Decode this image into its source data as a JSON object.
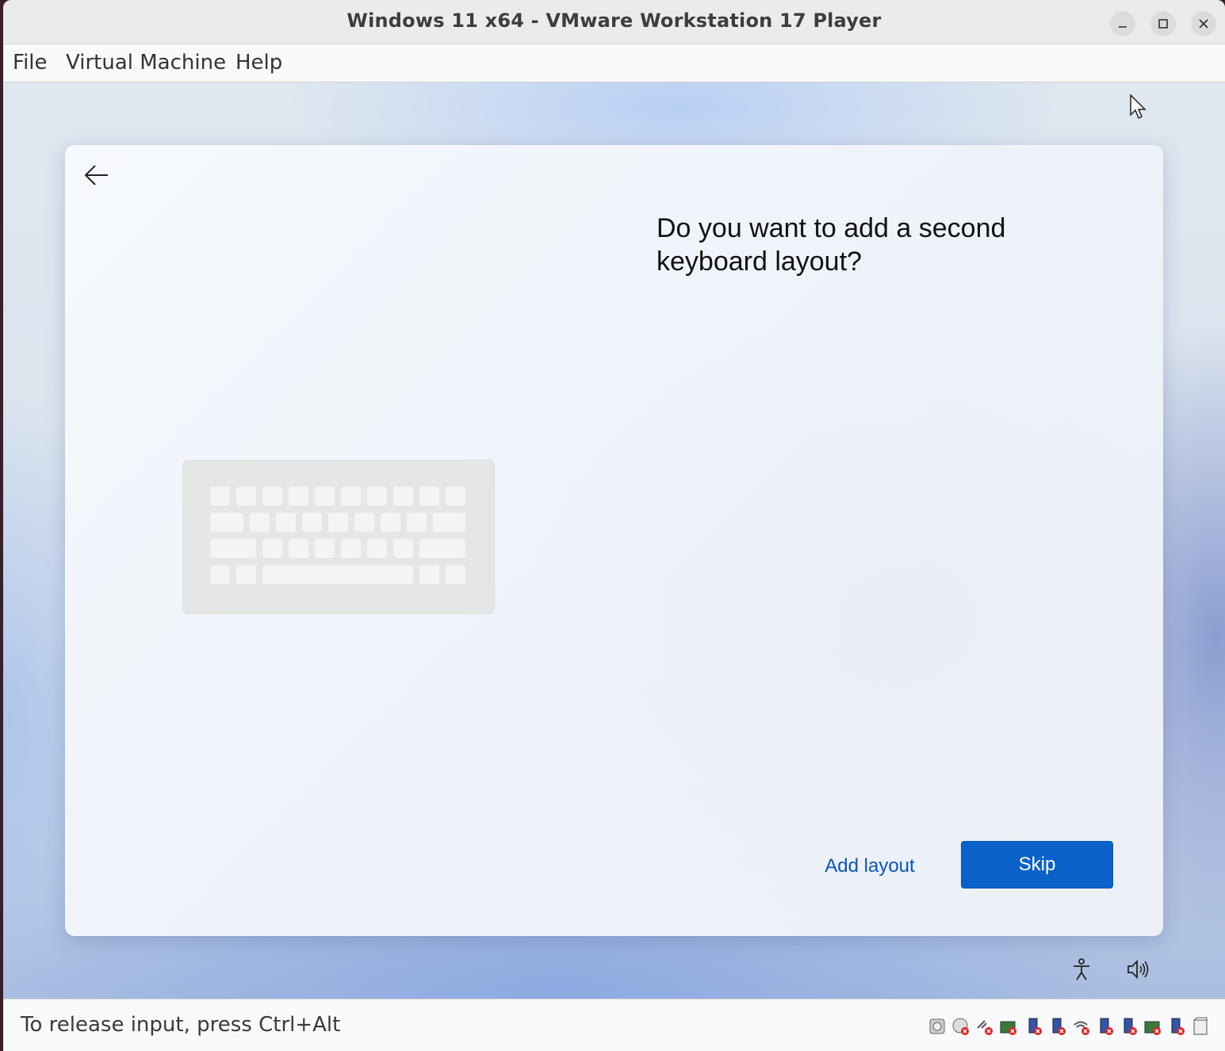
{
  "window": {
    "title": "Windows 11 x64 - VMware Workstation 17 Player"
  },
  "menu": {
    "items": [
      "File",
      "Virtual Machine",
      "Help"
    ]
  },
  "oobe": {
    "heading": "Do you want to add a second keyboard layout?",
    "add_layout_label": "Add layout",
    "skip_label": "Skip",
    "accent": "#0a62c9"
  },
  "status": {
    "text": "To release input, press Ctrl+Alt"
  },
  "devices": [
    "hard-disk-icon",
    "cd-dvd-icon",
    "floppy-icon",
    "network-adapter-icon",
    "usb-icon",
    "usb-icon",
    "sound-card-icon",
    "usb-icon",
    "usb-icon",
    "network-adapter-icon",
    "usb-icon",
    "printer-icon"
  ]
}
